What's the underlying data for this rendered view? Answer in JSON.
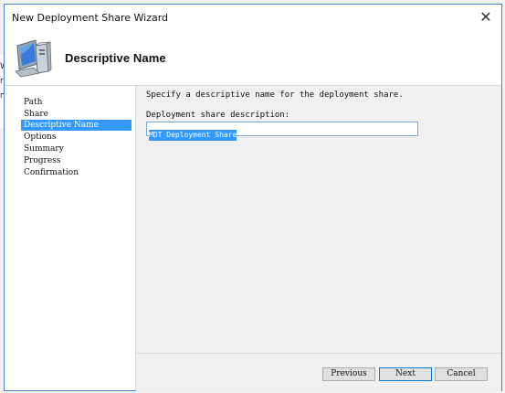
{
  "window": {
    "title": "New Deployment Share Wizard",
    "close_glyph": "✕"
  },
  "header": {
    "title": "Descriptive Name",
    "icon": "computer-icon"
  },
  "background": {
    "chars": [
      "W",
      "r",
      "m"
    ]
  },
  "steps": [
    {
      "label": "Path",
      "selected": false
    },
    {
      "label": "Share",
      "selected": false
    },
    {
      "label": "Descriptive Name",
      "selected": true
    },
    {
      "label": "Options",
      "selected": false
    },
    {
      "label": "Summary",
      "selected": false
    },
    {
      "label": "Progress",
      "selected": false
    },
    {
      "label": "Confirmation",
      "selected": false
    }
  ],
  "content": {
    "instruction": "Specify a descriptive name for the deployment share.",
    "field_label": "Deployment share description:",
    "field_value": "MDT Deployment Share"
  },
  "buttons": {
    "previous": "Previous",
    "next": "Next",
    "cancel": "Cancel"
  },
  "colors": {
    "selection": "#3399ff",
    "window_border": "#4a7fc1",
    "pane_bg": "#f0f0f0"
  }
}
